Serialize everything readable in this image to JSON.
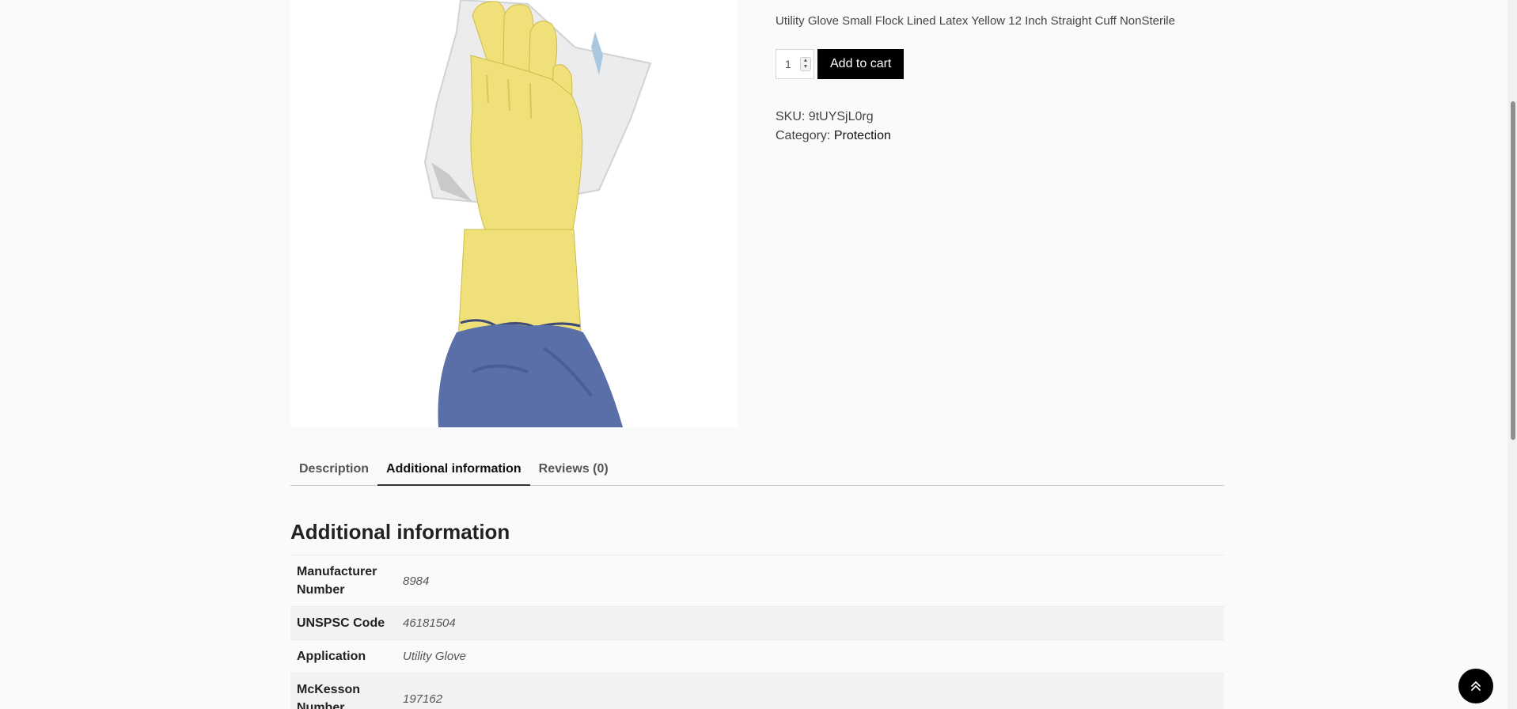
{
  "product": {
    "short_description": "Utility Glove Small Flock Lined Latex Yellow 12 Inch Straight Cuff NonSterile",
    "quantity": "1",
    "add_to_cart_label": "Add to cart",
    "sku_label": "SKU:",
    "sku_value": "9tUYSjL0rg",
    "category_label": "Category:",
    "category_value": "Protection"
  },
  "tabs": [
    {
      "label": "Description",
      "active": false
    },
    {
      "label": "Additional information",
      "active": true
    },
    {
      "label": "Reviews (0)",
      "active": false
    }
  ],
  "additional_info": {
    "title": "Additional information",
    "rows": [
      {
        "label": "Manufacturer Number",
        "value": "8984"
      },
      {
        "label": "UNSPSC Code",
        "value": "46181504"
      },
      {
        "label": "Application",
        "value": "Utility Glove"
      },
      {
        "label": "McKesson Number",
        "value": "197162"
      }
    ]
  },
  "icons": {
    "back_to_top": "double-chevron-up-icon",
    "quantity_spinner": "spinner-arrows-icon"
  },
  "colors": {
    "button_bg": "#000000",
    "glove_yellow": "#EFE07A",
    "sleeve_blue": "#5A6FA8"
  }
}
